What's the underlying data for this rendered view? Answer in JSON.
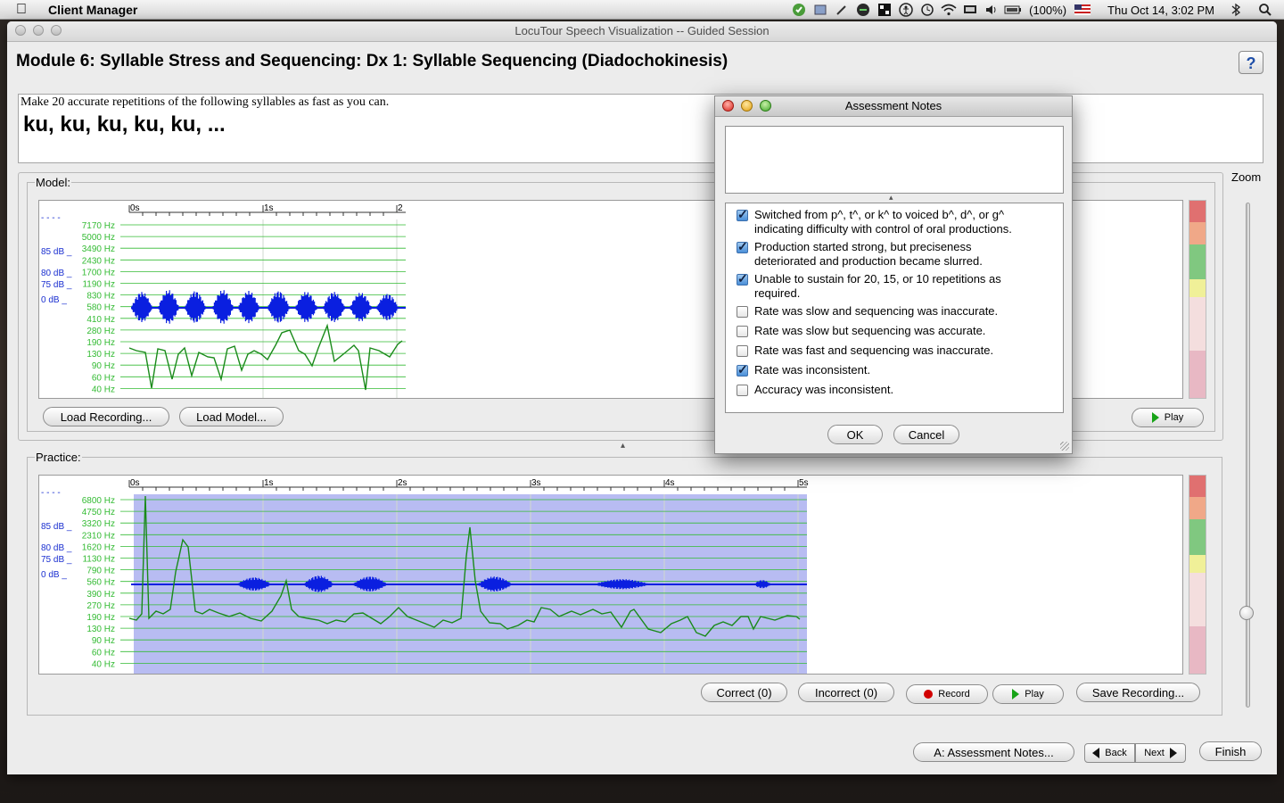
{
  "menubar": {
    "app_name": "Client Manager",
    "battery": "(100%)",
    "clock": "Thu Oct 14,  3:02 PM",
    "icons": [
      "evernote-icon",
      "scripts-icon",
      "tool-icon",
      "status-icon",
      "grid-icon",
      "accessibility-icon",
      "time-machine-icon",
      "wifi-icon",
      "display-icon",
      "volume-icon",
      "battery-icon",
      "flag-icon",
      "bluetooth-icon",
      "spotlight-icon"
    ]
  },
  "window": {
    "title": "LocuTour Speech Visualization -- Guided Session",
    "module_title": "Module 6: Syllable Stress and Sequencing: Dx 1: Syllable Sequencing (Diadochokinesis)",
    "help_label": "?",
    "instruction_text": "Make 20 accurate repetitions of the following syllables as fast as you can.",
    "instruction_syllables": "ku, ku, ku, ku, ku, ..."
  },
  "model": {
    "label": "Model:",
    "ticks": [
      "0s",
      "1s",
      "2"
    ],
    "db_labels": [
      "- - - -",
      "85 dB _",
      "80 dB _",
      "75 dB _",
      "0 dB _"
    ],
    "freq_labels": [
      "7170 Hz",
      "5000 Hz",
      "3490 Hz",
      "2430 Hz",
      "1700 Hz",
      "1190 Hz",
      "830 Hz",
      "580 Hz",
      "410 Hz",
      "280 Hz",
      "190 Hz",
      "130 Hz",
      "90 Hz",
      "60 Hz",
      "40 Hz"
    ],
    "load_recording": "Load Recording...",
    "load_model": "Load Model...",
    "play": "Play"
  },
  "practice": {
    "label": "Practice:",
    "ticks": [
      "0s",
      "1s",
      "2s",
      "3s",
      "4s",
      "5s"
    ],
    "db_labels": [
      "- - - -",
      "85 dB _",
      "80 dB _",
      "75 dB _",
      "0 dB _"
    ],
    "freq_labels": [
      "6800 Hz",
      "4750 Hz",
      "3320 Hz",
      "2310 Hz",
      "1620 Hz",
      "1130 Hz",
      "790 Hz",
      "560 Hz",
      "390 Hz",
      "270 Hz",
      "190 Hz",
      "130 Hz",
      "90 Hz",
      "60 Hz",
      "40 Hz"
    ],
    "correct": "Correct (0)",
    "incorrect": "Incorrect (0)",
    "record": "Record",
    "play": "Play",
    "save_recording": "Save Recording..."
  },
  "zoom": {
    "label": "Zoom"
  },
  "footer": {
    "assessment_notes": "A: Assessment Notes...",
    "back": "Back",
    "next": "Next",
    "finish": "Finish"
  },
  "dialog": {
    "title": "Assessment Notes",
    "notes_text": "",
    "items": [
      {
        "label_line1": "Switched from p^, t^, or k^ to voiced b^, d^, or g^",
        "label_line2": "indicating difficulty with control of oral productions.",
        "checked": true
      },
      {
        "label_line1": "Production started strong, but preciseness",
        "label_line2": "deteriorated and production became slurred.",
        "checked": true
      },
      {
        "label_line1": "Unable to sustain for 20, 15, or 10 repetitions as",
        "label_line2": "required.",
        "checked": true
      },
      {
        "label_line1": "Rate was slow and sequencing was inaccurate.",
        "label_line2": "",
        "checked": false
      },
      {
        "label_line1": "Rate was slow but sequencing was accurate.",
        "label_line2": "",
        "checked": false
      },
      {
        "label_line1": "Rate was fast and sequencing was inaccurate.",
        "label_line2": "",
        "checked": false
      },
      {
        "label_line1": "Rate was inconsistent.",
        "label_line2": "",
        "checked": true
      },
      {
        "label_line1": "Accuracy was inconsistent.",
        "label_line2": "",
        "checked": false
      }
    ],
    "ok": "OK",
    "cancel": "Cancel"
  },
  "colors": {
    "waveform": "#0a1fe0",
    "pitch": "#1a8a1a",
    "grid": "#33bb33",
    "practice_bg": "#b8bcf2",
    "meter": [
      "#e07070",
      "#f0a888",
      "#80c880",
      "#f0f098",
      "#f4dede",
      "#e8b8c4"
    ]
  }
}
